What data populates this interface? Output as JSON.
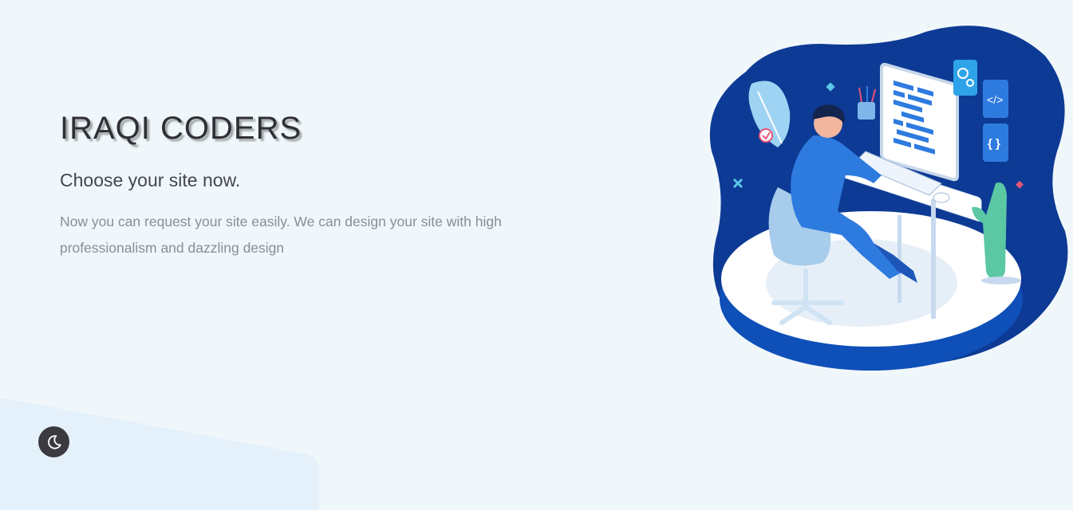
{
  "hero": {
    "title": "IRAQI CODERS",
    "tagline": "Choose your site now.",
    "description": "Now you can request your site easily. We can design your site with high professionalism and dazzling design"
  },
  "theme_toggle": {
    "icon": "moon-icon"
  },
  "illustration": {
    "subject": "developer-at-desk",
    "code_badge": "</>",
    "braces_badge": "{ }"
  },
  "colors": {
    "background": "#f0f7fb",
    "title": "#2f2f36",
    "tagline": "#444650",
    "description": "#8a8d95",
    "toggle": "#3a3a40",
    "illustration_blue": "#0d3a94",
    "accent_blue": "#2e7be0"
  }
}
